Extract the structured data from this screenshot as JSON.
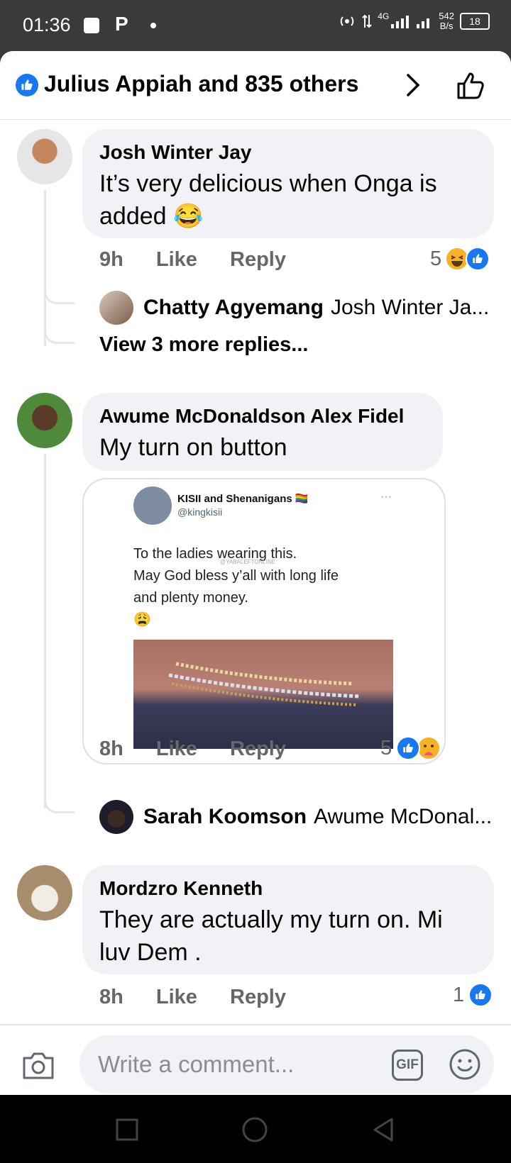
{
  "status_bar": {
    "time": "01:36",
    "p_icon": "P",
    "network": "4G",
    "speed_value": "542",
    "speed_unit": "B/s",
    "battery": "18"
  },
  "header": {
    "title": "Julius Appiah and 835 others"
  },
  "comments": [
    {
      "author": "Josh Winter Jay",
      "text": "It’s very delicious when Onga is added 😂",
      "time": "9h",
      "like_label": "Like",
      "reply_label": "Reply",
      "reaction_count": "5",
      "reply_preview": {
        "name": "Chatty Agyemang",
        "ref": "Josh Winter Ja..."
      },
      "view_more": "View 3 more replies..."
    },
    {
      "author": "Awume McDonaldson Alex Fidel",
      "text": "My turn on button",
      "time": "8h",
      "like_label": "Like",
      "reply_label": "Reply",
      "reaction_count": "5",
      "reply_preview": {
        "name": "Sarah Koomson",
        "ref": "Awume McDonal..."
      },
      "attachment": {
        "tweet_name": "KISII and Shenanigans 🏳️‍🌈",
        "tweet_handle": "@kingkisii",
        "tweet_line1": "To the ladies wearing this.",
        "tweet_line2": "May God bless y’all with long life",
        "tweet_line3": "and plenty money.",
        "tweet_emoji": "😩",
        "watermark": "@YABALEFTONLINE",
        "more": "···"
      }
    },
    {
      "author": "Mordzro Kenneth",
      "text": "They are actually my turn on. Mi luv Dem .",
      "time": "8h",
      "like_label": "Like",
      "reply_label": "Reply",
      "reaction_count": "1"
    }
  ],
  "composer": {
    "placeholder": "Write a comment...",
    "gif_label": "GIF"
  },
  "colors": {
    "accent": "#1877f2",
    "bubble": "#f0f2f5",
    "meta_text": "#65676b"
  }
}
